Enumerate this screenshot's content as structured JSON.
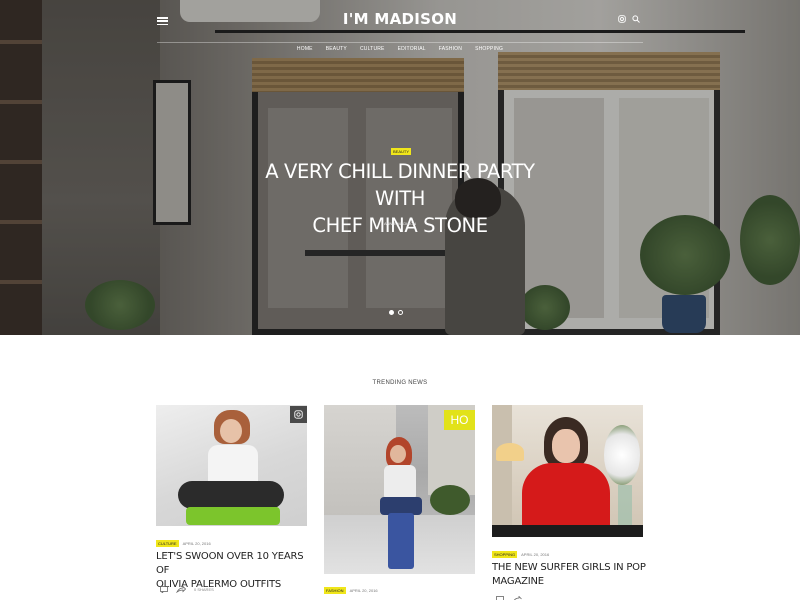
{
  "header": {
    "logo": "I'M MADISON",
    "nav": [
      "HOME",
      "BEAUTY",
      "CULTURE",
      "EDITORIAL",
      "FASHION",
      "SHOPPING"
    ]
  },
  "hero": {
    "tag": "BEAUTY",
    "title_line1": "A VERY CHILL DINNER PARTY WITH",
    "title_line2": "CHEF MINA STONE",
    "author": "ANNIE MADISON",
    "slides": 2,
    "active_slide": 1
  },
  "trending": {
    "title": "TRENDING NEWS",
    "articles": [
      {
        "category": "CULTURE",
        "date": "APRIL 20, 2016",
        "title_line1": "LET'S SWOON OVER 10 YEARS OF",
        "title_line2": "OLIVIA PALERMO OUTFITS",
        "shares": "0 SHARES"
      },
      {
        "category": "FASHION",
        "date": "APRIL 20, 2016"
      },
      {
        "category": "SHOPPING",
        "date": "APRIL 20, 2016",
        "title_line1": "THE NEW SURFER GIRLS IN POP",
        "title_line2": "MAGAZINE"
      }
    ]
  },
  "colors": {
    "accent": "#f0e61a",
    "text": "#222222",
    "hero_text": "#ffffff"
  },
  "icons": [
    "menu-icon",
    "instagram-icon",
    "search-icon",
    "comment-icon",
    "share-icon"
  ]
}
